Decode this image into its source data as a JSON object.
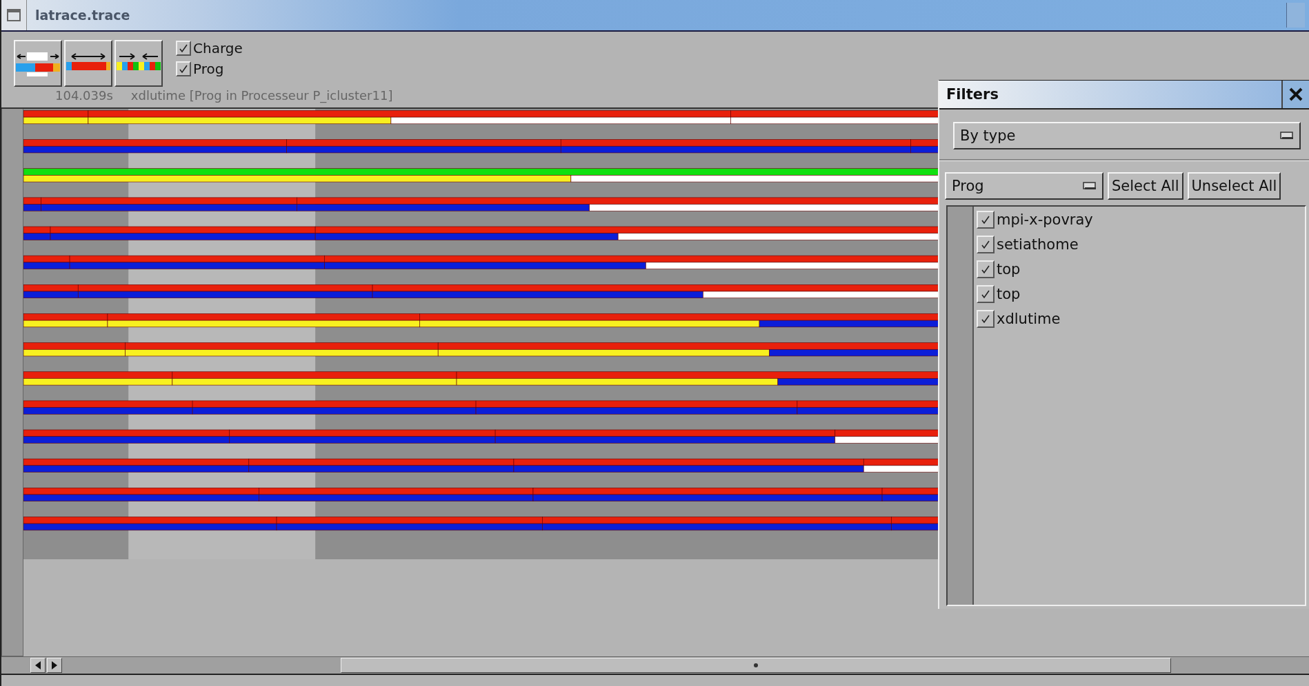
{
  "window": {
    "title": "latrace.trace"
  },
  "toolbar": {
    "checkboxes": [
      {
        "label": "Charge",
        "checked": true
      },
      {
        "label": "Prog",
        "checked": true
      }
    ],
    "time": "104.039s",
    "info": "xdlutime [Prog in Processeur P_icluster11]"
  },
  "filters": {
    "title": "Filters",
    "mode": "By type",
    "category": "Prog",
    "buttons": [
      "Select All",
      "Unselect All"
    ],
    "items": [
      {
        "label": "mpi-x-povray",
        "checked": true
      },
      {
        "label": "setiathome",
        "checked": true
      },
      {
        "label": "top",
        "checked": true
      },
      {
        "label": "top",
        "checked": true
      },
      {
        "label": "xdlutime",
        "checked": true
      }
    ]
  }
}
